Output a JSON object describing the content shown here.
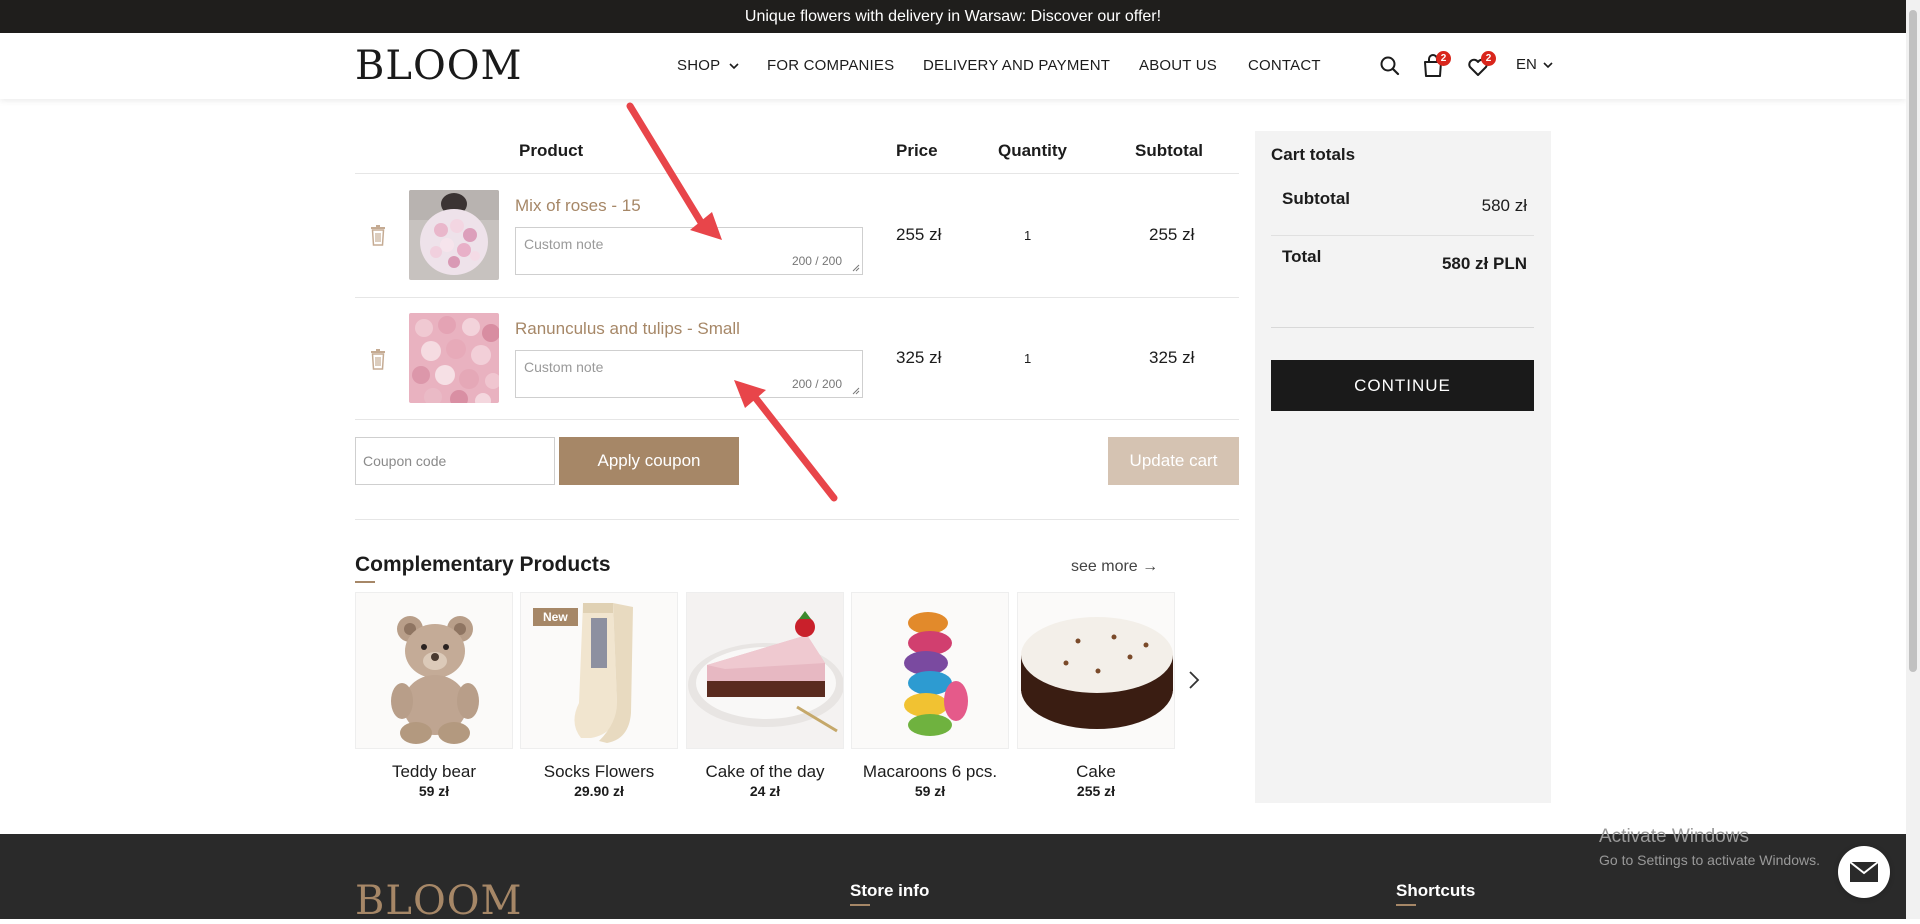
{
  "announcement": "Unique flowers with delivery in Warsaw: Discover our offer!",
  "header": {
    "logo": "BLOOM",
    "nav": [
      "SHOP",
      "FOR COMPANIES",
      "DELIVERY AND PAYMENT",
      "ABOUT US",
      "CONTACT"
    ],
    "cart_count": "2",
    "wishlist_count": "2",
    "language": "EN"
  },
  "cart": {
    "columns": {
      "product": "Product",
      "price": "Price",
      "quantity": "Quantity",
      "subtotal": "Subtotal"
    },
    "items": [
      {
        "name": "Mix of roses - 15",
        "note_placeholder": "Custom note",
        "note_counter": "200 / 200",
        "price": "255 zł",
        "quantity": "1",
        "subtotal": "255 zł"
      },
      {
        "name": "Ranunculus and tulips - Small",
        "note_placeholder": "Custom note",
        "note_counter": "200 / 200",
        "price": "325 zł",
        "quantity": "1",
        "subtotal": "325 zł"
      }
    ],
    "coupon_placeholder": "Coupon code",
    "apply_label": "Apply coupon",
    "update_label": "Update cart"
  },
  "totals": {
    "title": "Cart totals",
    "subtotal_label": "Subtotal",
    "subtotal_value": "580 zł",
    "total_label": "Total",
    "total_value": "580 zł PLN",
    "continue_label": "CONTINUE"
  },
  "complementary": {
    "title": "Complementary Products",
    "see_more": "see more →",
    "products": [
      {
        "name": "Teddy bear",
        "price": "59 zł"
      },
      {
        "name": "Socks Flowers",
        "price": "29.90 zł",
        "badge": "New"
      },
      {
        "name": "Cake of the day",
        "price": "24 zł"
      },
      {
        "name": "Macaroons 6 pcs.",
        "price": "59 zł"
      },
      {
        "name": "Cake",
        "price": "255 zł"
      }
    ]
  },
  "footer": {
    "logo": "BLOOM",
    "store_info": "Store info",
    "shortcuts": "Shortcuts"
  },
  "windows_notice": {
    "line1": "Activate Windows",
    "line2": "Go to Settings to activate Windows."
  },
  "colors": {
    "accent": "#a68767",
    "dark": "#1f1e1c",
    "badge_red": "#d9261c",
    "arrow_red": "#e8454a"
  }
}
